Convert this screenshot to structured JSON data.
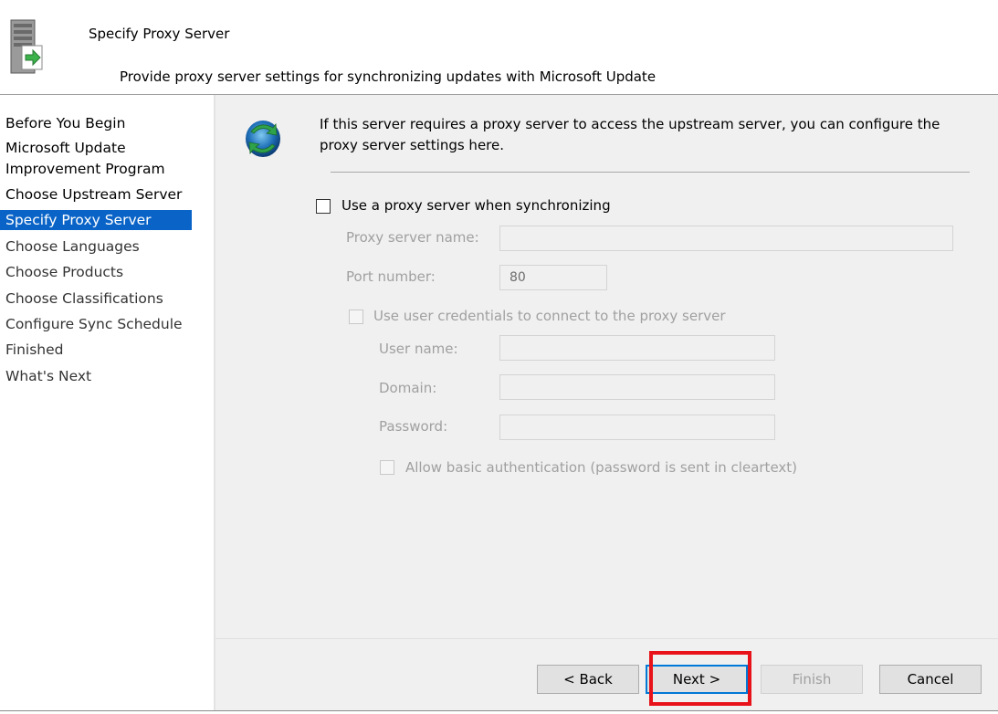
{
  "header": {
    "title": "Specify Proxy Server",
    "subtitle": "Provide proxy server settings for synchronizing updates with Microsoft Update",
    "icon": "server-wizard-icon"
  },
  "nav": {
    "items": [
      {
        "label": "Before You Begin",
        "state": "completed"
      },
      {
        "label": "Microsoft Update",
        "state": "completed"
      },
      {
        "label": "Improvement Program",
        "state": "completed"
      },
      {
        "label": "Choose Upstream Server",
        "state": "completed"
      },
      {
        "label": "Specify Proxy Server",
        "state": "active"
      },
      {
        "label": "Choose Languages",
        "state": "pending"
      },
      {
        "label": "Choose Products",
        "state": "pending"
      },
      {
        "label": "Choose Classifications",
        "state": "pending"
      },
      {
        "label": "Configure Sync Schedule",
        "state": "pending"
      },
      {
        "label": "Finished",
        "state": "pending"
      },
      {
        "label": "What's Next",
        "state": "pending"
      }
    ]
  },
  "content": {
    "intro_line1": "If this server requires a proxy server to access the upstream server, you can configure the",
    "intro_line2": "proxy server settings here.",
    "icon": "sync-icon",
    "use_proxy_label": "Use a proxy server when synchronizing",
    "use_proxy_checked": false,
    "proxy_name_label": "Proxy server name:",
    "proxy_name_value": "",
    "port_label": "Port number:",
    "port_value": "80",
    "credentials_label": "Use user credentials to connect to the proxy server",
    "credentials_checked": false,
    "user_name_label": "User name:",
    "user_name_value": "",
    "domain_label": "Domain:",
    "domain_value": "",
    "password_label": "Password:",
    "password_value": "",
    "basic_auth_label": "Allow basic authentication (password is sent in cleartext)",
    "basic_auth_checked": false
  },
  "buttons": {
    "back": "< Back",
    "next": "Next >",
    "finish": "Finish",
    "cancel": "Cancel"
  },
  "colors": {
    "accent": "#0a64c8",
    "highlight": "#e8121a",
    "default_button_border": "#0078d7"
  }
}
